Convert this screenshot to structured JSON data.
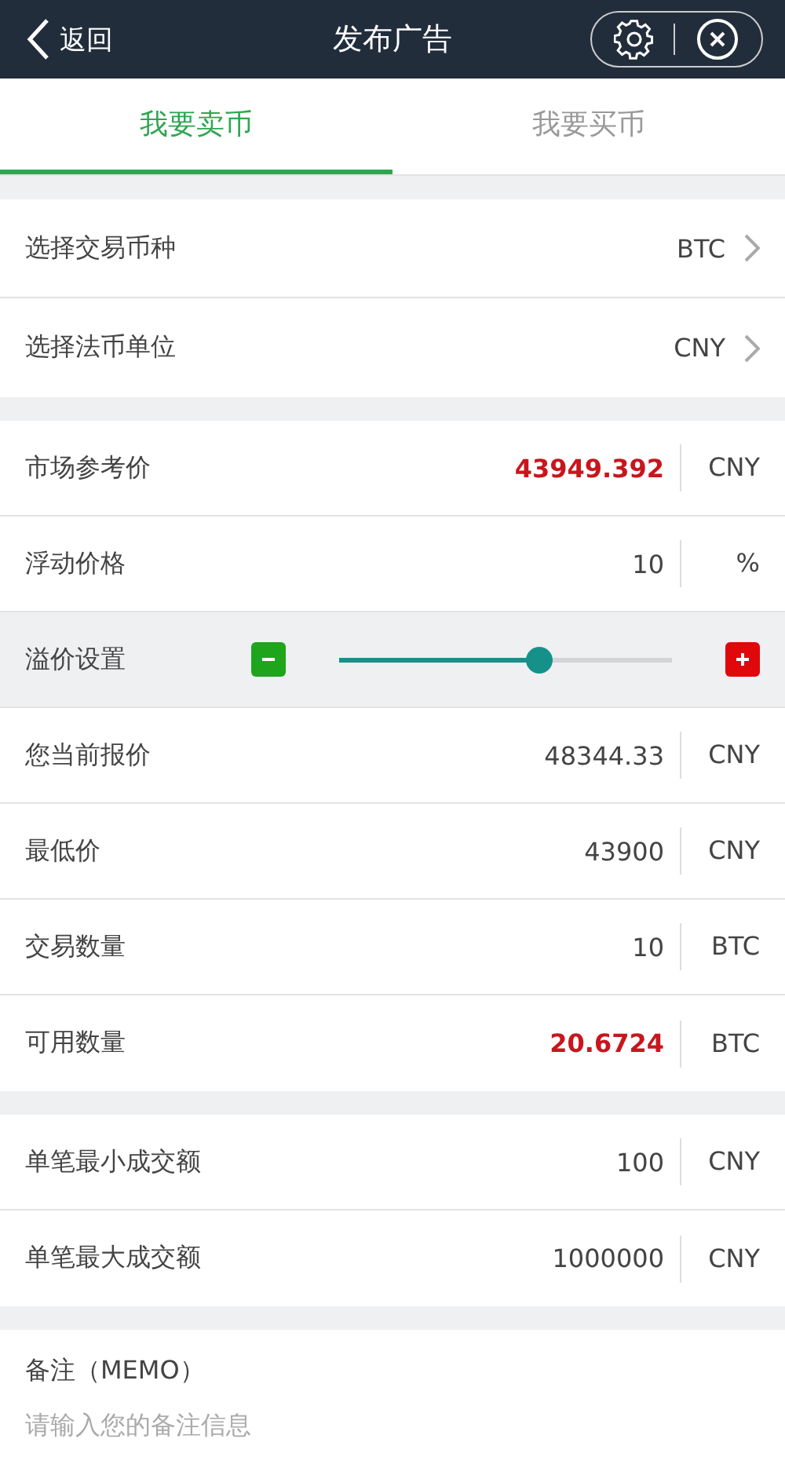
{
  "header": {
    "back_label": "返回",
    "title": "发布广告"
  },
  "tabs": [
    {
      "label": "我要卖币",
      "selected": true
    },
    {
      "label": "我要买币",
      "selected": false
    }
  ],
  "sections": [
    {
      "rows": [
        {
          "kind": "select",
          "label": "选择交易币种",
          "value": "BTC"
        },
        {
          "kind": "select",
          "label": "选择法币单位",
          "value": "CNY"
        }
      ]
    },
    {
      "rows": [
        {
          "kind": "value",
          "label": "市场参考价",
          "value": "43949.392",
          "unit": "CNY",
          "highlight": true
        },
        {
          "kind": "value",
          "label": "浮动价格",
          "value": "10",
          "unit": "%",
          "highlight": false
        },
        {
          "kind": "slider",
          "label": "溢价设置",
          "level": 0.6
        },
        {
          "kind": "value",
          "label": "您当前报价",
          "value": "48344.33",
          "unit": "CNY",
          "highlight": false
        },
        {
          "kind": "value",
          "label": "最低价",
          "value": "43900",
          "unit": "CNY",
          "highlight": false
        },
        {
          "kind": "value",
          "label": "交易数量",
          "value": "10",
          "unit": "BTC",
          "highlight": false
        },
        {
          "kind": "value",
          "label": "可用数量",
          "value": "20.6724",
          "unit": "BTC",
          "highlight": true
        }
      ]
    },
    {
      "rows": [
        {
          "kind": "value",
          "label": "单笔最小成交额",
          "value": "100",
          "unit": "CNY",
          "highlight": false
        },
        {
          "kind": "value",
          "label": "单笔最大成交额",
          "value": "1000000",
          "unit": "CNY",
          "highlight": false
        }
      ]
    }
  ],
  "memo": {
    "label": "备注（MEMO）",
    "placeholder": "请输入您的备注信息"
  }
}
